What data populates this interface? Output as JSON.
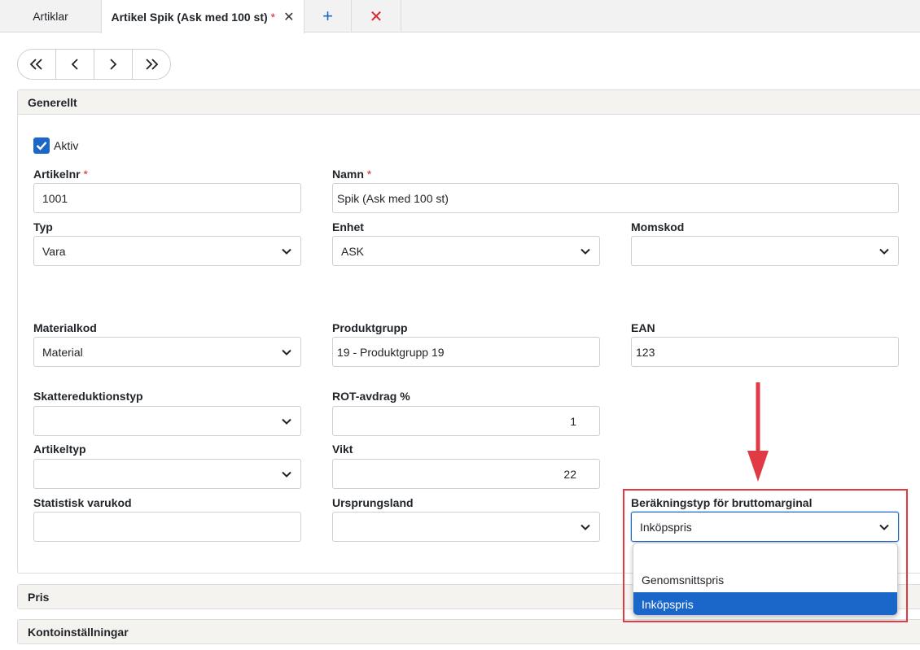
{
  "tabs": {
    "list_label": "Artiklar",
    "active_label": "Artikel Spik (Ask med 100 st)",
    "active_req": "*",
    "active_close": "✕",
    "add": "+",
    "close_all": "✕"
  },
  "nav": {
    "first": "«",
    "prev": "‹",
    "next": "›",
    "last": "»"
  },
  "general": {
    "title": "Generellt",
    "active_label": "Aktiv",
    "active_checked": true,
    "artikelnr": {
      "label": "Artikelnr",
      "req": "*",
      "value": "1001"
    },
    "namn": {
      "label": "Namn",
      "req": "*",
      "value": "Spik (Ask med 100 st)"
    },
    "typ": {
      "label": "Typ",
      "value": "Vara"
    },
    "enhet": {
      "label": "Enhet",
      "value": "ASK"
    },
    "momskod": {
      "label": "Momskod",
      "value": ""
    },
    "materialkod": {
      "label": "Materialkod",
      "value": "Material"
    },
    "produktgrupp": {
      "label": "Produktgrupp",
      "value": "19 - Produktgrupp 19"
    },
    "ean": {
      "label": "EAN",
      "value": "123"
    },
    "skattereduktionstyp": {
      "label": "Skattereduktionstyp",
      "value": ""
    },
    "rot": {
      "label": "ROT-avdrag %",
      "value": "1"
    },
    "artikeltyp": {
      "label": "Artikeltyp",
      "value": ""
    },
    "vikt": {
      "label": "Vikt",
      "value": "22"
    },
    "statistisk": {
      "label": "Statistisk varukod",
      "value": ""
    },
    "ursprungsland": {
      "label": "Ursprungsland",
      "value": ""
    },
    "bruttomarginal": {
      "label": "Beräkningstyp för bruttomarginal",
      "value": "Inköpspris",
      "options": [
        "",
        "Genomsnittspris",
        "Inköpspris"
      ],
      "selected_option": "Inköpspris"
    }
  },
  "pris": {
    "title": "Pris"
  },
  "konto": {
    "title": "Kontoinställningar"
  },
  "colors": {
    "accent": "#1a66c9",
    "required": "#d9262c",
    "annotation": "#e03a44"
  }
}
